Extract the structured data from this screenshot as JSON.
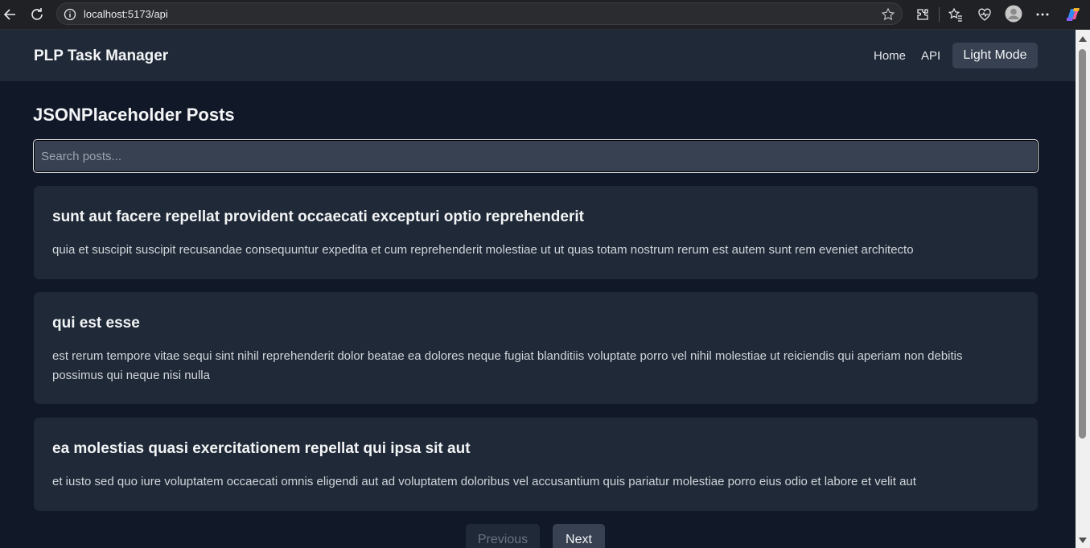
{
  "browser": {
    "url": "localhost:5173/api",
    "icons": [
      "back-arrow-icon",
      "refresh-icon",
      "info-icon",
      "star-icon",
      "extensions-icon",
      "favorites-icon",
      "health-icon",
      "profile-icon",
      "more-icon",
      "copilot-icon"
    ]
  },
  "navbar": {
    "brand": "PLP Task Manager",
    "links": [
      "Home",
      "API"
    ],
    "mode_button": "Light Mode"
  },
  "page": {
    "title": "JSONPlaceholder Posts",
    "search_placeholder": "Search posts..."
  },
  "posts": [
    {
      "title": "sunt aut facere repellat provident occaecati excepturi optio reprehenderit",
      "body": "quia et suscipit suscipit recusandae consequuntur expedita et cum reprehenderit molestiae ut ut quas totam nostrum rerum est autem sunt rem eveniet architecto"
    },
    {
      "title": "qui est esse",
      "body": "est rerum tempore vitae sequi sint nihil reprehenderit dolor beatae ea dolores neque fugiat blanditiis voluptate porro vel nihil molestiae ut reiciendis qui aperiam non debitis possimus qui neque nisi nulla"
    },
    {
      "title": "ea molestias quasi exercitationem repellat qui ipsa sit aut",
      "body": "et iusto sed quo iure voluptatem occaecati omnis eligendi aut ad voluptatem doloribus vel accusantium quis pariatur molestiae porro eius odio et labore et velit aut"
    }
  ],
  "pagination": {
    "previous": "Previous",
    "next": "Next"
  },
  "colors": {
    "page_bg": "#111827",
    "card_bg": "#1f2937",
    "button_bg": "#374151",
    "text": "#f3f4f6"
  }
}
